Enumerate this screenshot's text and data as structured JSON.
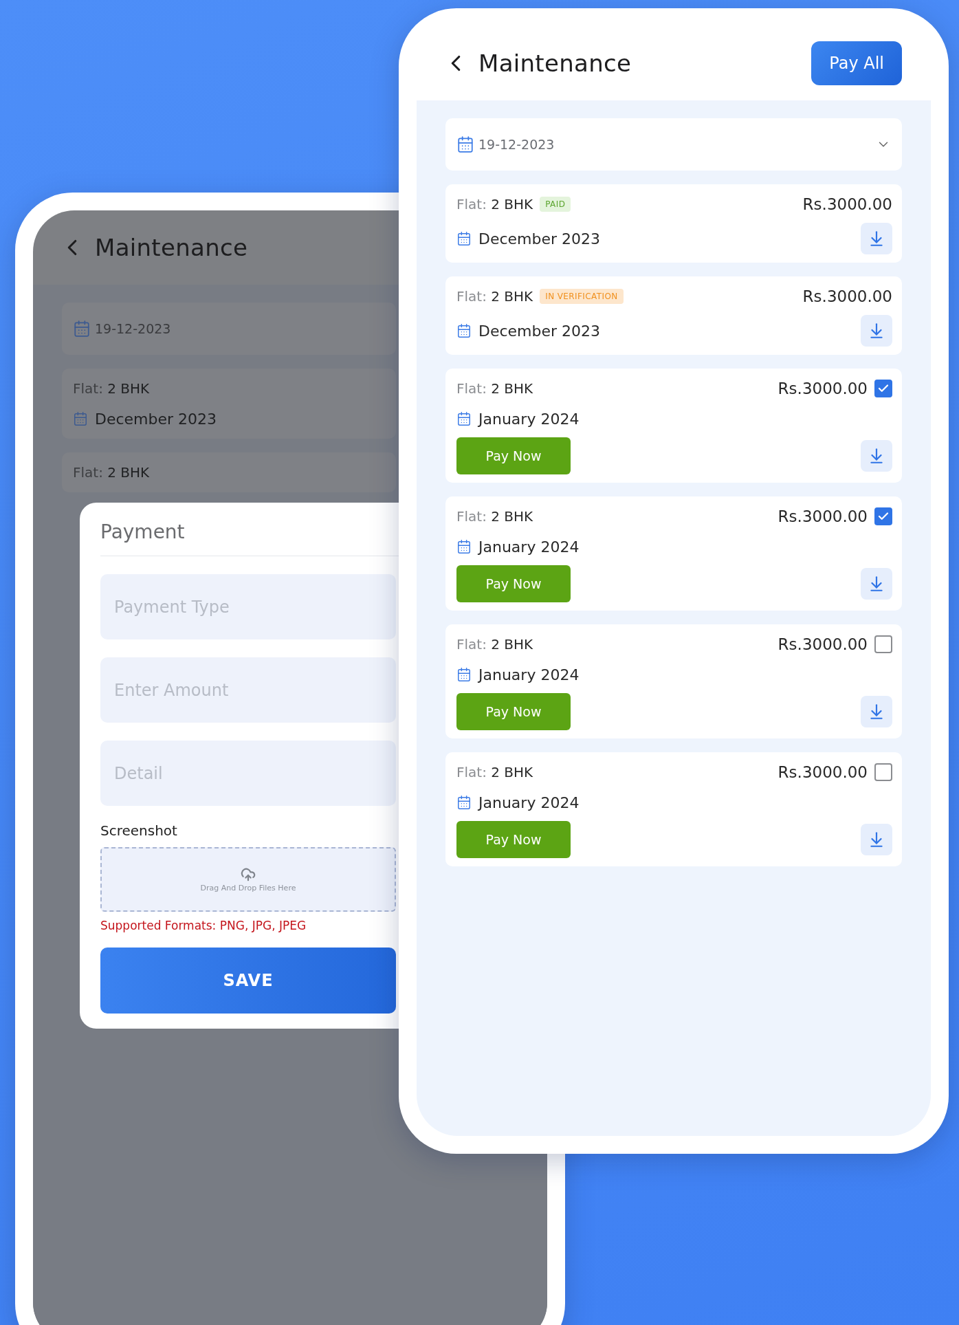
{
  "back_screen": {
    "header": {
      "title": "Maintenance"
    },
    "date_filter": {
      "value": "19-12-2023"
    },
    "bills": [
      {
        "flat_label": "Flat:",
        "flat_value": "2 BHK",
        "month": "December 2023"
      },
      {
        "flat_label": "Flat:",
        "flat_value": "2 BHK"
      }
    ]
  },
  "payment_dialog": {
    "title": "Payment",
    "fields": [
      {
        "placeholder": "Payment Type"
      },
      {
        "placeholder": "Enter Amount"
      },
      {
        "placeholder": "Detail"
      }
    ],
    "upload": {
      "label": "Screenshot",
      "hint": "Drag And Drop Files Here",
      "formats_note": "Supported Formats: PNG, JPG, JPEG"
    },
    "save_button": "SAVE"
  },
  "front_screen": {
    "header": {
      "title": "Maintenance",
      "action_button": "Pay All"
    },
    "date_filter": {
      "value": "19-12-2023"
    },
    "bills": [
      {
        "kind": "settled",
        "flat_label": "Flat:",
        "flat_value": "2 BHK",
        "status": {
          "kind": "paid",
          "label": "PAID"
        },
        "amount": "Rs.3000.00",
        "month": "December 2023"
      },
      {
        "kind": "settled",
        "flat_label": "Flat:",
        "flat_value": "2 BHK",
        "status": {
          "kind": "verification",
          "label": "IN VERIFICATION"
        },
        "amount": "Rs.3000.00",
        "month": "December 2023"
      },
      {
        "kind": "due",
        "flat_label": "Flat:",
        "flat_value": "2 BHK",
        "amount": "Rs.3000.00",
        "checked": true,
        "month": "January 2024",
        "pay_button": "Pay Now"
      },
      {
        "kind": "due",
        "flat_label": "Flat:",
        "flat_value": "2 BHK",
        "amount": "Rs.3000.00",
        "checked": true,
        "month": "January 2024",
        "pay_button": "Pay Now"
      },
      {
        "kind": "due",
        "flat_label": "Flat:",
        "flat_value": "2 BHK",
        "amount": "Rs.3000.00",
        "checked": false,
        "month": "January 2024",
        "pay_button": "Pay Now"
      },
      {
        "kind": "due",
        "flat_label": "Flat:",
        "flat_value": "2 BHK",
        "amount": "Rs.3000.00",
        "checked": false,
        "month": "January 2024",
        "pay_button": "Pay Now"
      }
    ]
  }
}
